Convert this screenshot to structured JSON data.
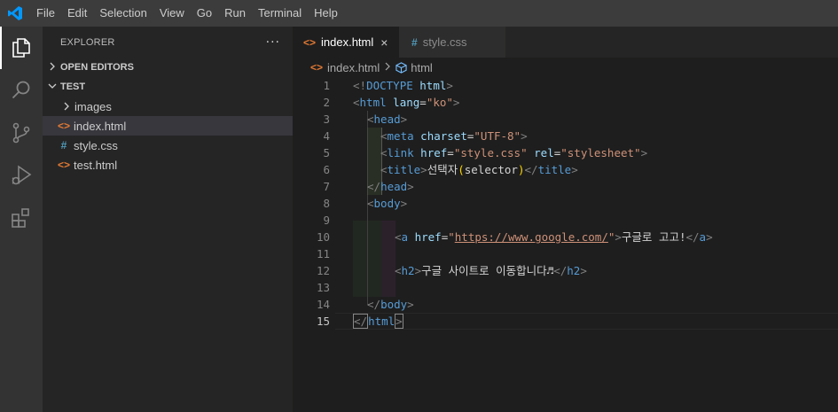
{
  "menu": [
    "File",
    "Edit",
    "Selection",
    "View",
    "Go",
    "Run",
    "Terminal",
    "Help"
  ],
  "colors": {
    "titlebar": "#3c3c3c",
    "activitybar": "#333333",
    "sidebar": "#252526",
    "editor": "#1e1e1e",
    "html_icon": "#e37933",
    "css_icon": "#519aba",
    "logo": "#0098ff"
  },
  "activity": [
    {
      "name": "files-icon",
      "active": true
    },
    {
      "name": "search-icon",
      "active": false
    },
    {
      "name": "source-control-icon",
      "active": false
    },
    {
      "name": "run-debug-icon",
      "active": false
    },
    {
      "name": "extensions-icon",
      "active": false
    }
  ],
  "sidebar": {
    "title": "EXPLORER",
    "more": "···",
    "open_editors": "OPEN EDITORS",
    "folder": "TEST",
    "items": [
      {
        "label": "images",
        "icon": "chevron-right-icon",
        "selected": false
      },
      {
        "label": "index.html",
        "icon": "html-file-icon",
        "selected": true
      },
      {
        "label": "style.css",
        "icon": "css-file-icon",
        "selected": false
      },
      {
        "label": "test.html",
        "icon": "html-file-icon",
        "selected": false
      }
    ]
  },
  "tabs": [
    {
      "label": "index.html",
      "icon": "html-file-icon",
      "active": true,
      "close": "×"
    },
    {
      "label": "style.css",
      "icon": "css-file-icon",
      "active": false
    }
  ],
  "breadcrumb": {
    "file": "index.html",
    "element": "html"
  },
  "editor": {
    "current_line": 15,
    "lines": [
      {
        "n": "1"
      },
      {
        "n": "2"
      },
      {
        "n": "3"
      },
      {
        "n": "4"
      },
      {
        "n": "5"
      },
      {
        "n": "6"
      },
      {
        "n": "7"
      },
      {
        "n": "8"
      },
      {
        "n": "9"
      },
      {
        "n": "10"
      },
      {
        "n": "11"
      },
      {
        "n": "12"
      },
      {
        "n": "13"
      },
      {
        "n": "14"
      },
      {
        "n": "15"
      }
    ],
    "code": {
      "l1": [
        "<!",
        "DOCTYPE",
        " ",
        "html",
        ">"
      ],
      "l2": [
        "<",
        "html",
        " ",
        "lang",
        "=",
        "\"ko\"",
        ">"
      ],
      "l3": [
        "<",
        "head",
        ">"
      ],
      "l4": [
        "<",
        "meta",
        " ",
        "charset",
        "=",
        "\"UTF-8\"",
        ">"
      ],
      "l5": [
        "<",
        "link",
        " ",
        "href",
        "=",
        "\"style.css\"",
        " ",
        "rel",
        "=",
        "\"stylesheet\"",
        ">"
      ],
      "l6": [
        "<",
        "title",
        ">",
        "선택자",
        "(",
        "selector",
        ")",
        "</",
        "title",
        ">"
      ],
      "l7": [
        "</",
        "head",
        ">"
      ],
      "l8": [
        "<",
        "body",
        ">"
      ],
      "l10": [
        "<",
        "a",
        " ",
        "href",
        "=",
        "\"",
        "https://www.google.com/",
        "\"",
        ">",
        "구글로 고고!",
        "</",
        "a",
        ">"
      ],
      "l12": [
        "<",
        "h2",
        ">",
        "구글 사이트로 이동합니다♬",
        "</",
        "h2",
        ">"
      ],
      "l14": [
        "</",
        "body",
        ">"
      ],
      "l15": [
        "</",
        "html",
        ">"
      ]
    }
  }
}
